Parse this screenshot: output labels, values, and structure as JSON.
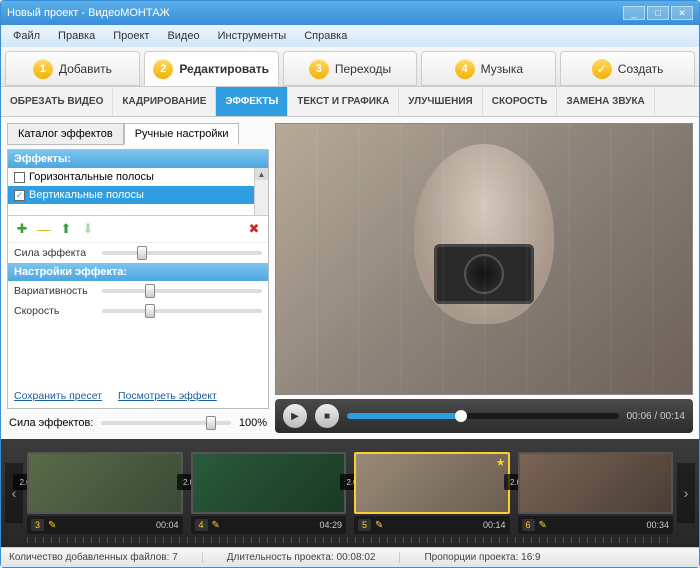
{
  "window": {
    "title": "Новый проект - ВидеоМОНТАЖ"
  },
  "menu": [
    "Файл",
    "Правка",
    "Проект",
    "Видео",
    "Инструменты",
    "Справка"
  ],
  "steps": [
    {
      "num": "1",
      "label": "Добавить"
    },
    {
      "num": "2",
      "label": "Редактировать"
    },
    {
      "num": "3",
      "label": "Переходы"
    },
    {
      "num": "4",
      "label": "Музыка"
    },
    {
      "num": "✓",
      "label": "Создать"
    }
  ],
  "active_step": 1,
  "subtabs": [
    "ОБРЕЗАТЬ ВИДЕО",
    "КАДРИРОВАНИЕ",
    "ЭФФЕКТЫ",
    "ТЕКСТ И ГРАФИКА",
    "УЛУЧШЕНИЯ",
    "СКОРОСТЬ",
    "ЗАМЕНА ЗВУКА"
  ],
  "active_subtab": 2,
  "inner_tabs": [
    "Каталог эффектов",
    "Ручные настройки"
  ],
  "active_inner": 1,
  "effects_header": "Эффекты:",
  "effects": [
    {
      "label": "Горизонтальные полосы",
      "checked": false,
      "selected": false
    },
    {
      "label": "Вертикальные полосы",
      "checked": true,
      "selected": true
    }
  ],
  "icon_bar": {
    "add": "✚",
    "remove": "—",
    "up": "⬆",
    "down": "⬇",
    "delete": "✖"
  },
  "strength_label": "Сила эффекта",
  "settings_header": "Настройки эффекта:",
  "params": [
    {
      "label": "Вариативность",
      "pos": 30
    },
    {
      "label": "Скорость",
      "pos": 30
    }
  ],
  "links": {
    "save": "Сохранить пресет",
    "preview": "Посмотреть эффект"
  },
  "overall_strength": {
    "label": "Сила эффектов:",
    "value": "100%",
    "pos": 85
  },
  "player": {
    "current": "00:06",
    "total": "00:14",
    "sep": " / "
  },
  "transition_dur": "2.0",
  "clips": [
    {
      "idx": "3",
      "dur": "00:04",
      "cls": "",
      "sel": false
    },
    {
      "idx": "4",
      "dur": "04:29",
      "cls": "c4",
      "sel": false
    },
    {
      "idx": "5",
      "dur": "00:14",
      "cls": "c5",
      "sel": true
    },
    {
      "idx": "6",
      "dur": "00:34",
      "cls": "c6",
      "sel": false
    }
  ],
  "status": {
    "files_label": "Количество добавленных файлов:",
    "files_val": "7",
    "dur_label": "Длительность проекта:",
    "dur_val": "00:08:02",
    "aspect_label": "Пропорции проекта:",
    "aspect_val": "16:9"
  }
}
